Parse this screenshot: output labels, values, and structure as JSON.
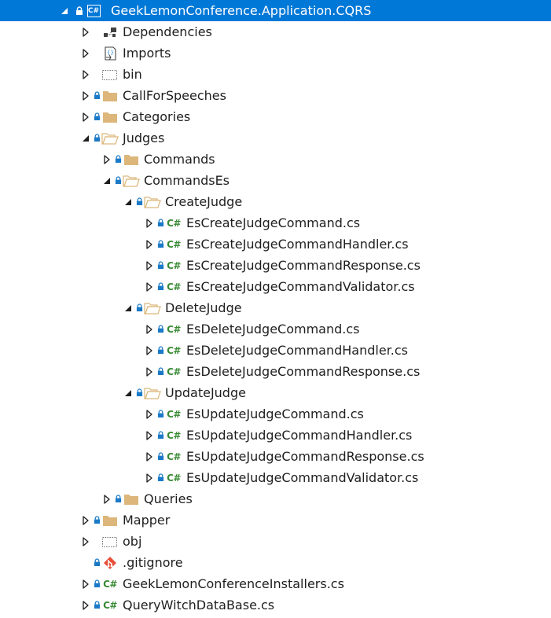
{
  "colors": {
    "selection": "#0078d7",
    "folder": "#dcb67a",
    "csharp": "#388a34",
    "lock": "#1b7ac7",
    "git": "#e8503a"
  },
  "project": {
    "label": "GeekLemonConference.Application.CQRS",
    "icon": "csharp-project-icon",
    "project_badge": "C#"
  },
  "csharp_badge": "C#",
  "nodes": [
    {
      "label": "Dependencies",
      "icon": "dependencies-icon",
      "expander": "collapsed"
    },
    {
      "label": "Imports",
      "icon": "imports-icon",
      "expander": "collapsed"
    },
    {
      "label": "bin",
      "icon": "dotted-folder-icon",
      "expander": "collapsed"
    },
    {
      "label": "CallForSpeeches",
      "icon": "folder-icon",
      "expander": "collapsed"
    },
    {
      "label": "Categories",
      "icon": "folder-icon",
      "expander": "collapsed"
    },
    {
      "label": "Judges",
      "icon": "folder-open-icon",
      "expander": "expanded"
    },
    {
      "label": "Commands",
      "icon": "folder-icon",
      "expander": "collapsed"
    },
    {
      "label": "CommandsEs",
      "icon": "folder-open-icon",
      "expander": "expanded"
    },
    {
      "label": "CreateJudge",
      "icon": "folder-open-icon",
      "expander": "expanded"
    },
    {
      "label": "EsCreateJudgeCommand.cs",
      "icon": "csharp-file-icon",
      "expander": "collapsed"
    },
    {
      "label": "EsCreateJudgeCommandHandler.cs",
      "icon": "csharp-file-icon",
      "expander": "collapsed"
    },
    {
      "label": "EsCreateJudgeCommandResponse.cs",
      "icon": "csharp-file-icon",
      "expander": "collapsed"
    },
    {
      "label": "EsCreateJudgeCommandValidator.cs",
      "icon": "csharp-file-icon",
      "expander": "collapsed"
    },
    {
      "label": "DeleteJudge",
      "icon": "folder-open-icon",
      "expander": "expanded"
    },
    {
      "label": "EsDeleteJudgeCommand.cs",
      "icon": "csharp-file-icon",
      "expander": "collapsed"
    },
    {
      "label": "EsDeleteJudgeCommandHandler.cs",
      "icon": "csharp-file-icon",
      "expander": "collapsed"
    },
    {
      "label": "EsDeleteJudgeCommandResponse.cs",
      "icon": "csharp-file-icon",
      "expander": "collapsed"
    },
    {
      "label": "UpdateJudge",
      "icon": "folder-open-icon",
      "expander": "expanded"
    },
    {
      "label": "EsUpdateJudgeCommand.cs",
      "icon": "csharp-file-icon",
      "expander": "collapsed"
    },
    {
      "label": "EsUpdateJudgeCommandHandler.cs",
      "icon": "csharp-file-icon",
      "expander": "collapsed"
    },
    {
      "label": "EsUpdateJudgeCommandResponse.cs",
      "icon": "csharp-file-icon",
      "expander": "collapsed"
    },
    {
      "label": "EsUpdateJudgeCommandValidator.cs",
      "icon": "csharp-file-icon",
      "expander": "collapsed"
    },
    {
      "label": "Queries",
      "icon": "folder-icon",
      "expander": "collapsed"
    },
    {
      "label": "Mapper",
      "icon": "folder-icon",
      "expander": "collapsed"
    },
    {
      "label": "obj",
      "icon": "dotted-folder-icon",
      "expander": "collapsed"
    },
    {
      "label": ".gitignore",
      "icon": "git-icon",
      "expander": "none"
    },
    {
      "label": "GeekLemonConferenceInstallers.cs",
      "icon": "csharp-file-icon",
      "expander": "collapsed"
    },
    {
      "label": "QueryWitchDataBase.cs",
      "icon": "csharp-file-icon",
      "expander": "collapsed"
    }
  ]
}
